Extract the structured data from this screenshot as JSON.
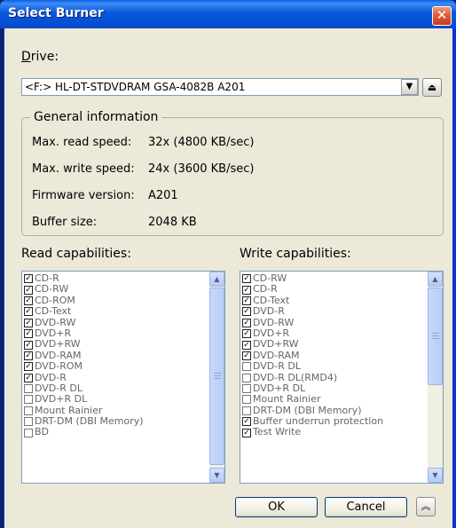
{
  "window": {
    "title": "Select Burner",
    "close_glyph": "✕"
  },
  "drive": {
    "label": "Drive:",
    "label_accel": "D",
    "label_rest": "rive:",
    "selected": "<F:> HL-DT-STDVDRAM GSA-4082B A201",
    "dropdown_icon": "chevron-down-icon",
    "eject_icon": "eject-icon"
  },
  "general": {
    "legend": "General information",
    "rows": [
      {
        "label": "Max. read speed:",
        "value": "32x (4800 KB/sec)"
      },
      {
        "label": "Max. write speed:",
        "value": "24x (3600 KB/sec)"
      },
      {
        "label": "Firmware version:",
        "value": "A201"
      },
      {
        "label": "Buffer size:",
        "value": "2048 KB"
      }
    ]
  },
  "read": {
    "label": "Read capabilities:",
    "items": [
      {
        "label": "CD-R",
        "checked": true
      },
      {
        "label": "CD-RW",
        "checked": true
      },
      {
        "label": "CD-ROM",
        "checked": true
      },
      {
        "label": "CD-Text",
        "checked": true
      },
      {
        "label": "DVD-RW",
        "checked": true
      },
      {
        "label": "DVD+R",
        "checked": true
      },
      {
        "label": "DVD+RW",
        "checked": true
      },
      {
        "label": "DVD-RAM",
        "checked": true
      },
      {
        "label": "DVD-ROM",
        "checked": true
      },
      {
        "label": "DVD-R",
        "checked": true
      },
      {
        "label": "DVD-R DL",
        "checked": false
      },
      {
        "label": "DVD+R DL",
        "checked": false
      },
      {
        "label": "Mount Rainier",
        "checked": false
      },
      {
        "label": "DRT-DM (DBI Memory)",
        "checked": false
      },
      {
        "label": "BD",
        "checked": false
      }
    ]
  },
  "write": {
    "label": "Write capabilities:",
    "items": [
      {
        "label": "CD-RW",
        "checked": true
      },
      {
        "label": "CD-R",
        "checked": true
      },
      {
        "label": "CD-Text",
        "checked": true
      },
      {
        "label": "DVD-R",
        "checked": true
      },
      {
        "label": "DVD-RW",
        "checked": true
      },
      {
        "label": "DVD+R",
        "checked": true
      },
      {
        "label": "DVD+RW",
        "checked": true
      },
      {
        "label": "DVD-RAM",
        "checked": true
      },
      {
        "label": "DVD-R DL",
        "checked": false
      },
      {
        "label": "DVD-R DL(RMD4)",
        "checked": false
      },
      {
        "label": "DVD+R DL",
        "checked": false
      },
      {
        "label": "Mount Rainier",
        "checked": false
      },
      {
        "label": "DRT-DM (DBI Memory)",
        "checked": false
      },
      {
        "label": "Buffer underrun protection",
        "checked": true
      },
      {
        "label": "Test Write",
        "checked": true
      }
    ]
  },
  "buttons": {
    "ok": "OK",
    "cancel": "Cancel",
    "more_icon": "double-chevron-up-icon"
  }
}
